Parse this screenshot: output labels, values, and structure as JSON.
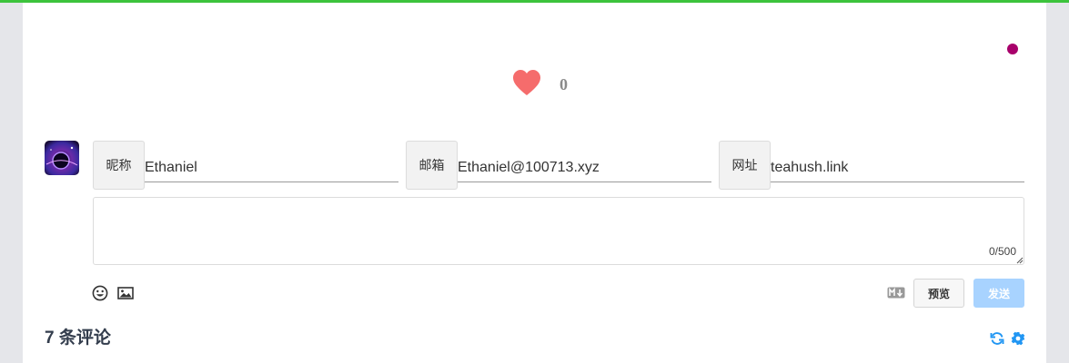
{
  "reaction": {
    "like_count": "0",
    "heart_color": "#f56c6c"
  },
  "form": {
    "nick_label": "昵称",
    "nick_value": "Ethaniel",
    "mail_label": "邮箱",
    "mail_value": "Ethaniel@100713.xyz",
    "link_label": "网址",
    "link_value": "teahush.link",
    "comment_value": "",
    "counter": "0/500"
  },
  "toolbar": {
    "emoji_icon": "emoji-icon",
    "image_icon": "image-icon",
    "markdown_icon": "markdown-icon",
    "preview_label": "预览",
    "submit_label": "发送"
  },
  "comments": {
    "count_label": "7 条评论"
  },
  "colors": {
    "accent": "#2196f3",
    "send_disabled": "#a8d3ff",
    "topbar": "#3cc33c",
    "dot": "#a8006b"
  }
}
